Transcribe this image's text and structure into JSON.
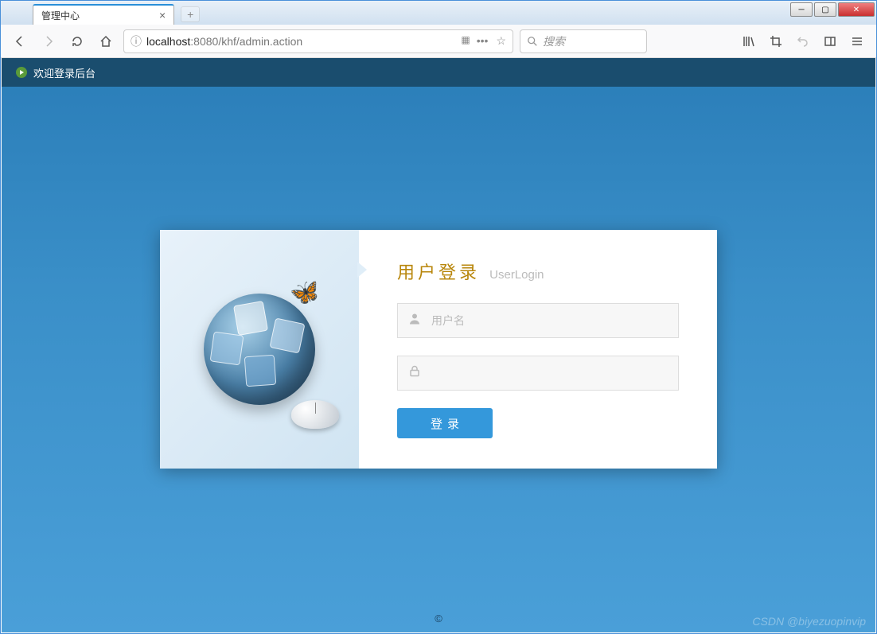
{
  "window": {
    "tab_title": "管理中心"
  },
  "toolbar": {
    "url_prefix": "localhost",
    "url_port": ":8080",
    "url_path": "/khf/admin.action",
    "search_placeholder": "搜索"
  },
  "page": {
    "header_text": "欢迎登录后台",
    "login_title": "用户登录",
    "login_subtitle": "UserLogin",
    "username_placeholder": "用户名",
    "password_placeholder": "",
    "login_button": "登录",
    "footer": "©",
    "watermark": "CSDN @biyezuopinvip"
  }
}
